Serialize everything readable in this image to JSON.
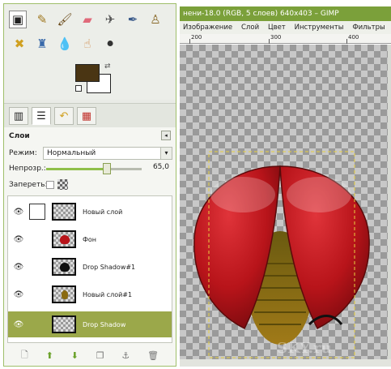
{
  "toolbox": {
    "tools": [
      "pencil-icon",
      "brush-icon",
      "eraser-icon",
      "airbrush-icon",
      "ink-icon",
      "clone-stamp-icon",
      "heal-icon",
      "perspective-clone-icon",
      "blur-icon",
      "smudge-icon",
      "dodge-burn-icon"
    ],
    "fg_color": "#4a3513",
    "bg_color": "#ffffff"
  },
  "dock_tabs": [
    "layers-tab-icon",
    "channels-tab-icon",
    "paths-tab-icon",
    "undo-tab-icon",
    "gradients-tab-icon"
  ],
  "layers_panel": {
    "title": "Слои",
    "mode_label": "Режим:",
    "mode_value": "Нормальный",
    "opacity_label": "Непрозр.:",
    "opacity_value": "65,0",
    "opacity_fraction": 0.65,
    "lock_label": "Запереть:",
    "layers": [
      {
        "name": "Новый слой",
        "thumb": "transparent",
        "selected": false
      },
      {
        "name": "Фон",
        "thumb": "red-blob",
        "selected": false
      },
      {
        "name": "Drop Shadow#1",
        "thumb": "black-blob",
        "selected": false
      },
      {
        "name": "Новый слой#1",
        "thumb": "brown-blob",
        "selected": false
      },
      {
        "name": "Drop Shadow",
        "thumb": "transparent",
        "selected": true
      }
    ]
  },
  "image_window": {
    "title": "нени-18.0 (RGB, 5 слоев) 640x403 – GIMP",
    "menu": [
      "Изображение",
      "Слой",
      "Цвет",
      "Инструменты",
      "Фильтры"
    ],
    "ruler_labels": [
      "200",
      "300",
      "400"
    ],
    "watermark": "SKY.ru"
  },
  "colors": {
    "accent_green": "#7ba03a",
    "selected_row": "#9ba84a",
    "ladybug_red": "#b8141a",
    "body_brown": "#8a6a10"
  }
}
